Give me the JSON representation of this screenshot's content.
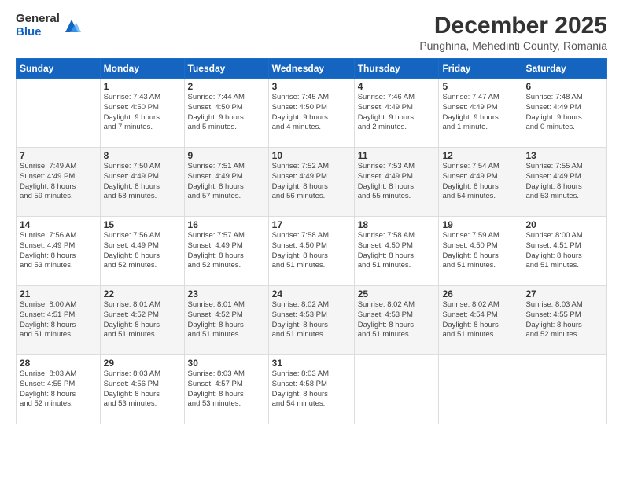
{
  "logo": {
    "general": "General",
    "blue": "Blue"
  },
  "title": "December 2025",
  "subtitle": "Punghina, Mehedinti County, Romania",
  "weekdays": [
    "Sunday",
    "Monday",
    "Tuesday",
    "Wednesday",
    "Thursday",
    "Friday",
    "Saturday"
  ],
  "weeks": [
    [
      {
        "day": "",
        "info": ""
      },
      {
        "day": "1",
        "info": "Sunrise: 7:43 AM\nSunset: 4:50 PM\nDaylight: 9 hours\nand 7 minutes."
      },
      {
        "day": "2",
        "info": "Sunrise: 7:44 AM\nSunset: 4:50 PM\nDaylight: 9 hours\nand 5 minutes."
      },
      {
        "day": "3",
        "info": "Sunrise: 7:45 AM\nSunset: 4:50 PM\nDaylight: 9 hours\nand 4 minutes."
      },
      {
        "day": "4",
        "info": "Sunrise: 7:46 AM\nSunset: 4:49 PM\nDaylight: 9 hours\nand 2 minutes."
      },
      {
        "day": "5",
        "info": "Sunrise: 7:47 AM\nSunset: 4:49 PM\nDaylight: 9 hours\nand 1 minute."
      },
      {
        "day": "6",
        "info": "Sunrise: 7:48 AM\nSunset: 4:49 PM\nDaylight: 9 hours\nand 0 minutes."
      }
    ],
    [
      {
        "day": "7",
        "info": "Sunrise: 7:49 AM\nSunset: 4:49 PM\nDaylight: 8 hours\nand 59 minutes."
      },
      {
        "day": "8",
        "info": "Sunrise: 7:50 AM\nSunset: 4:49 PM\nDaylight: 8 hours\nand 58 minutes."
      },
      {
        "day": "9",
        "info": "Sunrise: 7:51 AM\nSunset: 4:49 PM\nDaylight: 8 hours\nand 57 minutes."
      },
      {
        "day": "10",
        "info": "Sunrise: 7:52 AM\nSunset: 4:49 PM\nDaylight: 8 hours\nand 56 minutes."
      },
      {
        "day": "11",
        "info": "Sunrise: 7:53 AM\nSunset: 4:49 PM\nDaylight: 8 hours\nand 55 minutes."
      },
      {
        "day": "12",
        "info": "Sunrise: 7:54 AM\nSunset: 4:49 PM\nDaylight: 8 hours\nand 54 minutes."
      },
      {
        "day": "13",
        "info": "Sunrise: 7:55 AM\nSunset: 4:49 PM\nDaylight: 8 hours\nand 53 minutes."
      }
    ],
    [
      {
        "day": "14",
        "info": "Sunrise: 7:56 AM\nSunset: 4:49 PM\nDaylight: 8 hours\nand 53 minutes."
      },
      {
        "day": "15",
        "info": "Sunrise: 7:56 AM\nSunset: 4:49 PM\nDaylight: 8 hours\nand 52 minutes."
      },
      {
        "day": "16",
        "info": "Sunrise: 7:57 AM\nSunset: 4:49 PM\nDaylight: 8 hours\nand 52 minutes."
      },
      {
        "day": "17",
        "info": "Sunrise: 7:58 AM\nSunset: 4:50 PM\nDaylight: 8 hours\nand 51 minutes."
      },
      {
        "day": "18",
        "info": "Sunrise: 7:58 AM\nSunset: 4:50 PM\nDaylight: 8 hours\nand 51 minutes."
      },
      {
        "day": "19",
        "info": "Sunrise: 7:59 AM\nSunset: 4:50 PM\nDaylight: 8 hours\nand 51 minutes."
      },
      {
        "day": "20",
        "info": "Sunrise: 8:00 AM\nSunset: 4:51 PM\nDaylight: 8 hours\nand 51 minutes."
      }
    ],
    [
      {
        "day": "21",
        "info": "Sunrise: 8:00 AM\nSunset: 4:51 PM\nDaylight: 8 hours\nand 51 minutes."
      },
      {
        "day": "22",
        "info": "Sunrise: 8:01 AM\nSunset: 4:52 PM\nDaylight: 8 hours\nand 51 minutes."
      },
      {
        "day": "23",
        "info": "Sunrise: 8:01 AM\nSunset: 4:52 PM\nDaylight: 8 hours\nand 51 minutes."
      },
      {
        "day": "24",
        "info": "Sunrise: 8:02 AM\nSunset: 4:53 PM\nDaylight: 8 hours\nand 51 minutes."
      },
      {
        "day": "25",
        "info": "Sunrise: 8:02 AM\nSunset: 4:53 PM\nDaylight: 8 hours\nand 51 minutes."
      },
      {
        "day": "26",
        "info": "Sunrise: 8:02 AM\nSunset: 4:54 PM\nDaylight: 8 hours\nand 51 minutes."
      },
      {
        "day": "27",
        "info": "Sunrise: 8:03 AM\nSunset: 4:55 PM\nDaylight: 8 hours\nand 52 minutes."
      }
    ],
    [
      {
        "day": "28",
        "info": "Sunrise: 8:03 AM\nSunset: 4:55 PM\nDaylight: 8 hours\nand 52 minutes."
      },
      {
        "day": "29",
        "info": "Sunrise: 8:03 AM\nSunset: 4:56 PM\nDaylight: 8 hours\nand 53 minutes."
      },
      {
        "day": "30",
        "info": "Sunrise: 8:03 AM\nSunset: 4:57 PM\nDaylight: 8 hours\nand 53 minutes."
      },
      {
        "day": "31",
        "info": "Sunrise: 8:03 AM\nSunset: 4:58 PM\nDaylight: 8 hours\nand 54 minutes."
      },
      {
        "day": "",
        "info": ""
      },
      {
        "day": "",
        "info": ""
      },
      {
        "day": "",
        "info": ""
      }
    ]
  ]
}
